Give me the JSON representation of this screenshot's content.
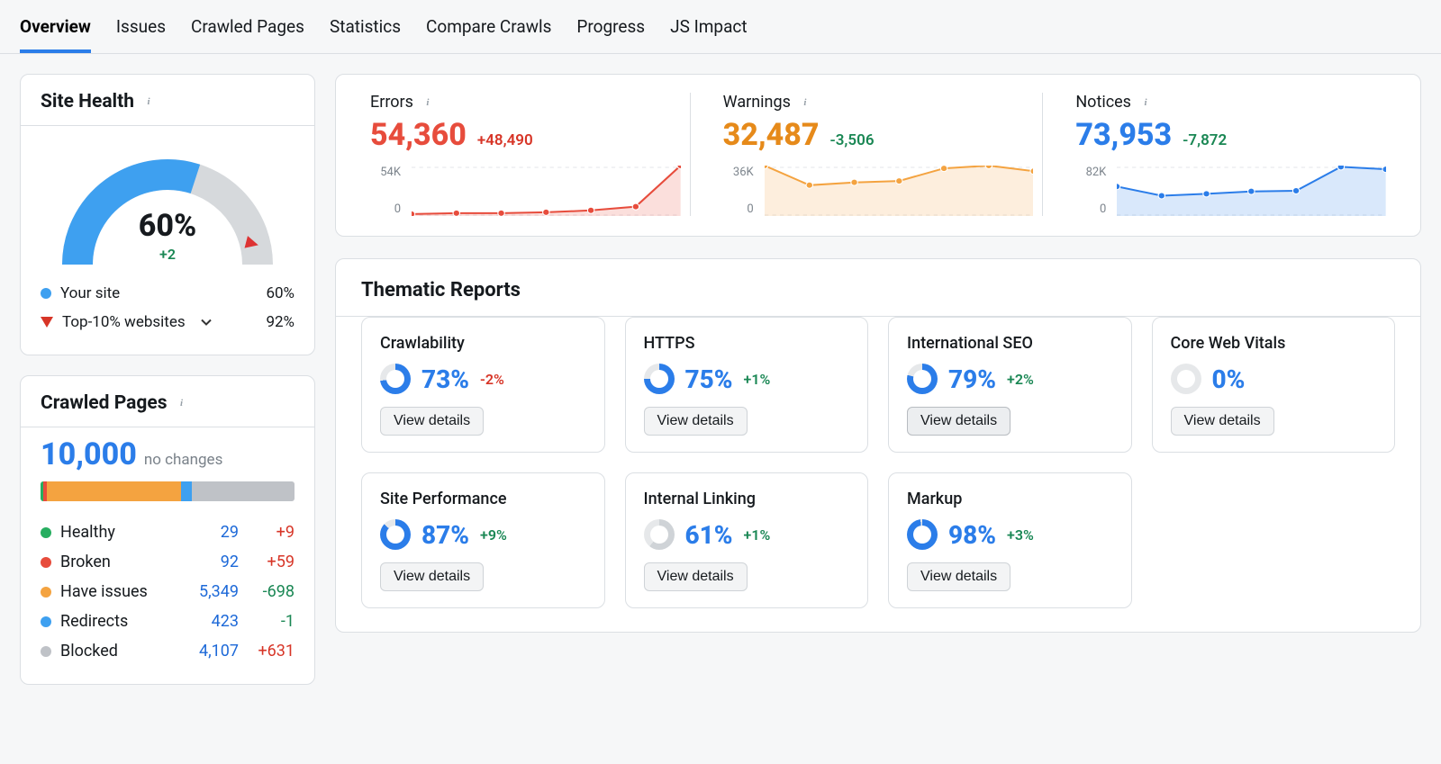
{
  "tabs": [
    {
      "label": "Overview",
      "active": true
    },
    {
      "label": "Issues"
    },
    {
      "label": "Crawled Pages"
    },
    {
      "label": "Statistics"
    },
    {
      "label": "Compare Crawls"
    },
    {
      "label": "Progress"
    },
    {
      "label": "JS Impact"
    }
  ],
  "site_health": {
    "title": "Site Health",
    "percent": "60%",
    "delta": "+2",
    "gauge_pct": 60,
    "legend": {
      "your_site": {
        "label": "Your site",
        "value": "60%"
      },
      "top10": {
        "label": "Top-10% websites",
        "value": "92%"
      }
    }
  },
  "metrics": {
    "errors": {
      "title": "Errors",
      "value": "54,360",
      "delta": "+48,490",
      "color": "#e74c3c",
      "delta_color": "#d73527",
      "axis_top": "54K",
      "axis_bottom": "0"
    },
    "warnings": {
      "title": "Warnings",
      "value": "32,487",
      "delta": "-3,506",
      "color": "#e68a1a",
      "delta_color": "#1a8754",
      "axis_top": "36K",
      "axis_bottom": "0"
    },
    "notices": {
      "title": "Notices",
      "value": "73,953",
      "delta": "-7,872",
      "color": "#2b7de9",
      "delta_color": "#1a8754",
      "axis_top": "82K",
      "axis_bottom": "0"
    }
  },
  "chart_data": [
    {
      "type": "line",
      "name": "errors",
      "x": [
        1,
        2,
        3,
        4,
        5,
        6,
        7
      ],
      "values": [
        2,
        3,
        3,
        4,
        6,
        10,
        54
      ],
      "ylim": [
        0,
        54
      ],
      "xlabel": "",
      "ylabel": "",
      "color": "#e74c3c",
      "fill": true
    },
    {
      "type": "line",
      "name": "warnings",
      "x": [
        1,
        2,
        3,
        4,
        5,
        6,
        7
      ],
      "values": [
        36,
        22,
        24,
        25,
        34,
        36,
        32
      ],
      "ylim": [
        0,
        36
      ],
      "xlabel": "",
      "ylabel": "",
      "color": "#f4a340",
      "fill": true
    },
    {
      "type": "line",
      "name": "notices",
      "x": [
        1,
        2,
        3,
        4,
        5,
        6,
        7
      ],
      "values": [
        48,
        33,
        36,
        40,
        41,
        80,
        76
      ],
      "ylim": [
        0,
        82
      ],
      "xlabel": "",
      "ylabel": "",
      "color": "#2b7de9",
      "fill": true
    }
  ],
  "crawled": {
    "title": "Crawled Pages",
    "total": "10,000",
    "change": "no changes",
    "segments": [
      {
        "label": "Healthy",
        "color": "#27ae60",
        "count": 29,
        "delta": "+9",
        "delta_sign": "pos"
      },
      {
        "label": "Broken",
        "color": "#e74c3c",
        "count": 92,
        "delta": "+59",
        "delta_sign": "pos"
      },
      {
        "label": "Have issues",
        "color": "#f4a340",
        "count": 5349,
        "count_disp": "5,349",
        "delta": "-698",
        "delta_sign": "neg"
      },
      {
        "label": "Redirects",
        "color": "#3ea0f0",
        "count": 423,
        "delta": "-1",
        "delta_sign": "neg"
      },
      {
        "label": "Blocked",
        "color": "#bfc2c7",
        "count": 4107,
        "count_disp": "4,107",
        "delta": "+631",
        "delta_sign": "pos"
      }
    ]
  },
  "thematic": {
    "title": "Thematic Reports",
    "button_label": "View details",
    "reports": [
      {
        "title": "Crawlability",
        "pct": "73%",
        "pct_num": 73,
        "delta": "-2%",
        "delta_sign": "pos",
        "ring": "#2b7de9"
      },
      {
        "title": "HTTPS",
        "pct": "75%",
        "pct_num": 75,
        "delta": "+1%",
        "delta_sign": "neg",
        "ring": "#2b7de9"
      },
      {
        "title": "International SEO",
        "pct": "79%",
        "pct_num": 79,
        "delta": "+2%",
        "delta_sign": "neg",
        "ring": "#2b7de9",
        "hover": true
      },
      {
        "title": "Core Web Vitals",
        "pct": "0%",
        "pct_num": 0,
        "delta": "",
        "delta_sign": "",
        "ring": "#cfd3d7"
      },
      {
        "title": "Site Performance",
        "pct": "87%",
        "pct_num": 87,
        "delta": "+9%",
        "delta_sign": "neg",
        "ring": "#2b7de9"
      },
      {
        "title": "Internal Linking",
        "pct": "61%",
        "pct_num": 61,
        "delta": "+1%",
        "delta_sign": "neg",
        "ring": "#cfd3d7",
        "ring2": "#2b7de9"
      },
      {
        "title": "Markup",
        "pct": "98%",
        "pct_num": 98,
        "delta": "+3%",
        "delta_sign": "neg",
        "ring": "#2b7de9"
      }
    ]
  }
}
